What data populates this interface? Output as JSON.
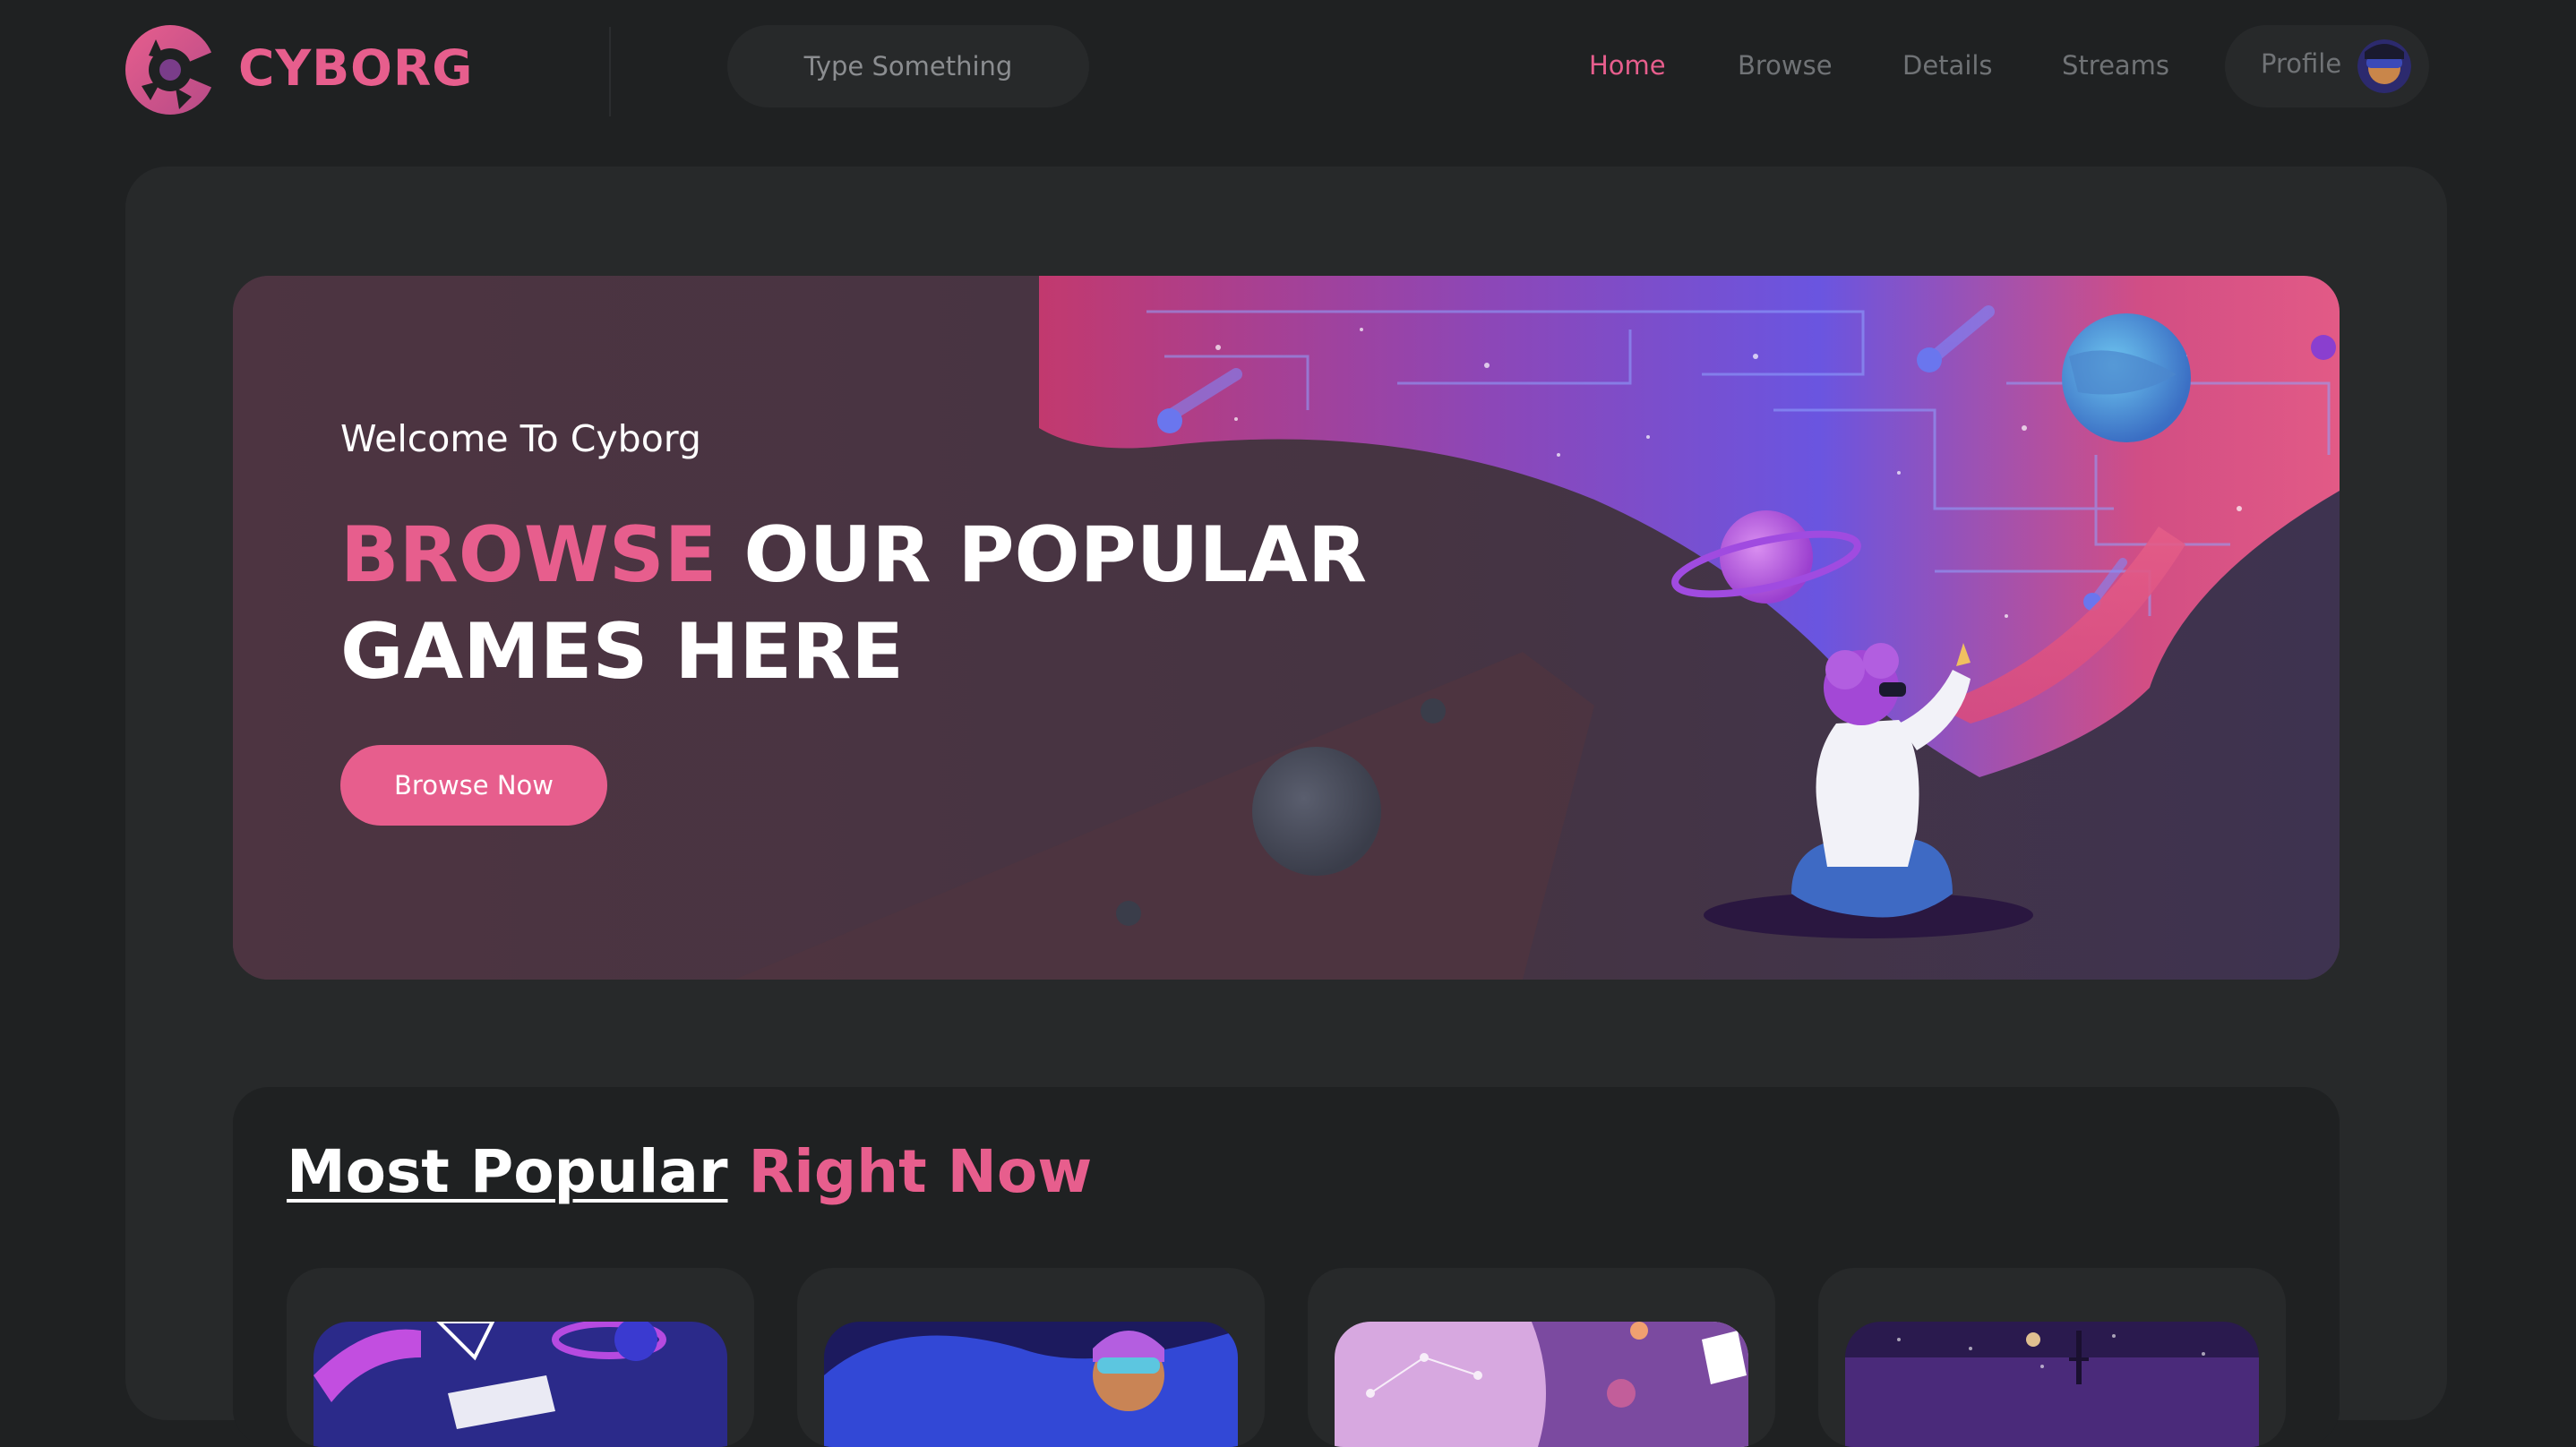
{
  "brand": {
    "name": "CYBORG",
    "logo_icon": "cyborg-logo-icon",
    "accent": "#e75e8d"
  },
  "search": {
    "placeholder": "Type Something"
  },
  "nav": {
    "items": [
      {
        "label": "Home",
        "active": true
      },
      {
        "label": "Browse",
        "active": false
      },
      {
        "label": "Details",
        "active": false
      },
      {
        "label": "Streams",
        "active": false
      }
    ],
    "profile_label": "Profile"
  },
  "banner": {
    "welcome": "Welcome To Cyborg",
    "headline_accent": "BROWSE",
    "headline_rest_1": "OUR POPULAR",
    "headline_rest_2": "GAMES HERE",
    "button_label": "Browse Now"
  },
  "popular": {
    "heading_underlined": "Most Popular",
    "heading_accent": "Right Now",
    "cards": [
      {
        "thumb": "game-thumb-1"
      },
      {
        "thumb": "game-thumb-2"
      },
      {
        "thumb": "game-thumb-3"
      },
      {
        "thumb": "game-thumb-4"
      }
    ]
  },
  "colors": {
    "background": "#1f2122",
    "panel": "#27292a",
    "accent": "#e75e8d",
    "muted_text": "#707376"
  }
}
